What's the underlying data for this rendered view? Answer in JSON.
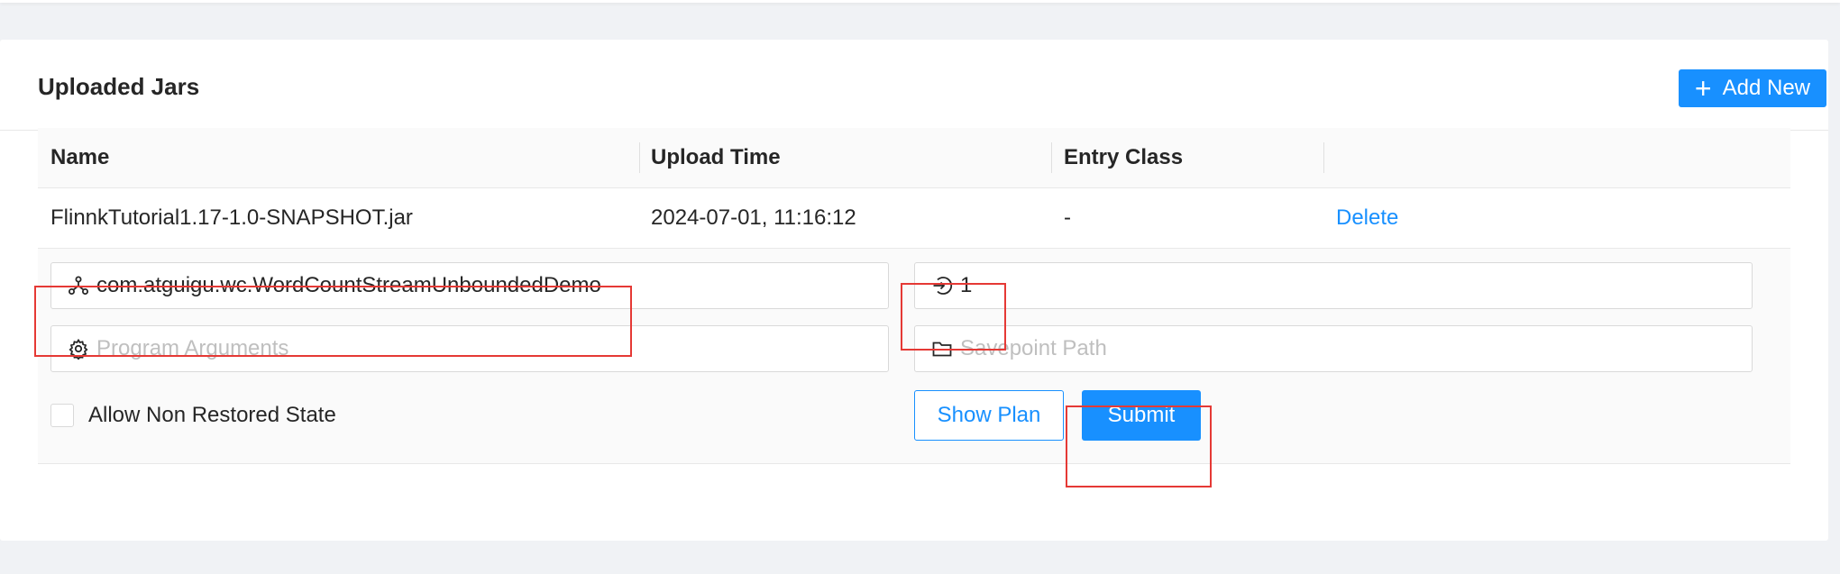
{
  "card": {
    "title": "Uploaded Jars",
    "add_button_label": "Add New"
  },
  "table": {
    "columns": [
      "Name",
      "Upload Time",
      "Entry Class",
      ""
    ],
    "rows": [
      {
        "name": "FlinnkTutorial1.17-1.0-SNAPSHOT.jar",
        "upload_time": "2024-07-01, 11:16:12",
        "entry_class": "-",
        "action": "Delete"
      }
    ]
  },
  "submit_form": {
    "entry_class_value": "com.atguigu.wc.WordCountStreamUnboundedDemo",
    "parallelism_value": "1",
    "program_args_placeholder": "Program Arguments",
    "savepoint_placeholder": "Savepoint Path",
    "allow_non_restored_label": "Allow Non Restored State",
    "allow_non_restored_checked": false,
    "show_plan_label": "Show Plan",
    "submit_label": "Submit"
  },
  "icons": {
    "add": "plus-icon",
    "entry_class": "cluster-icon",
    "parallelism": "login-icon",
    "program_args": "setting-icon",
    "savepoint": "folder-icon"
  },
  "colors": {
    "primary": "#1890ff",
    "highlight": "#e53935"
  }
}
